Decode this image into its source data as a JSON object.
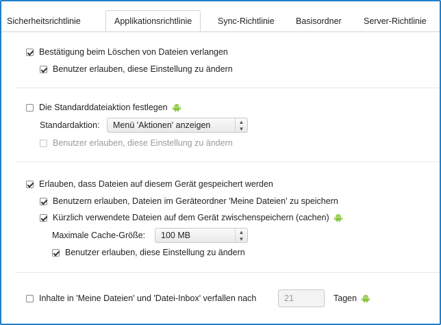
{
  "tabs": [
    {
      "label": "Sicherheitsrichtlinie"
    },
    {
      "label": "Applikationsrichtlinie"
    },
    {
      "label": "Sync-Richtlinie"
    },
    {
      "label": "Basisordner"
    },
    {
      "label": "Server-Richtlinie"
    }
  ],
  "active_tab": "Applikationsrichtlinie",
  "sections": {
    "delete_confirm": {
      "label": "Bestätigung beim Löschen von Dateien verlangen",
      "checked": true,
      "allow_user_change": {
        "label": "Benutzer erlauben, diese Einstellung zu ändern",
        "checked": true
      }
    },
    "default_action": {
      "label": "Die Standarddateiaktion festlegen",
      "checked": false,
      "action_label": "Standardaktion:",
      "action_value": "Menü 'Aktionen' anzeigen",
      "allow_user_change": {
        "label": "Benutzer erlauben, diese Einstellung zu ändern",
        "checked": false
      }
    },
    "allow_storage": {
      "label": "Erlauben, dass Dateien auf diesem Gerät gespeichert werden",
      "checked": true,
      "save_my_files": {
        "label": "Benutzern erlauben, Dateien im Geräteordner 'Meine Dateien' zu speichern",
        "checked": true
      },
      "cache_recent": {
        "label": "Kürzlich verwendete Dateien auf dem Gerät zwischenspeichern (cachen)",
        "checked": true
      },
      "cache_size_label": "Maximale Cache-Größe:",
      "cache_size_value": "100 MB",
      "allow_user_change": {
        "label": "Benutzer erlauben, diese Einstellung zu ändern",
        "checked": true
      }
    },
    "expire": {
      "label": "Inhalte in 'Meine Dateien' und 'Datei-Inbox' verfallen nach",
      "checked": false,
      "days_value": "21",
      "days_unit": "Tagen"
    }
  },
  "colors": {
    "frame_border": "#1f7ecb",
    "android_green": "#8cc63f"
  }
}
